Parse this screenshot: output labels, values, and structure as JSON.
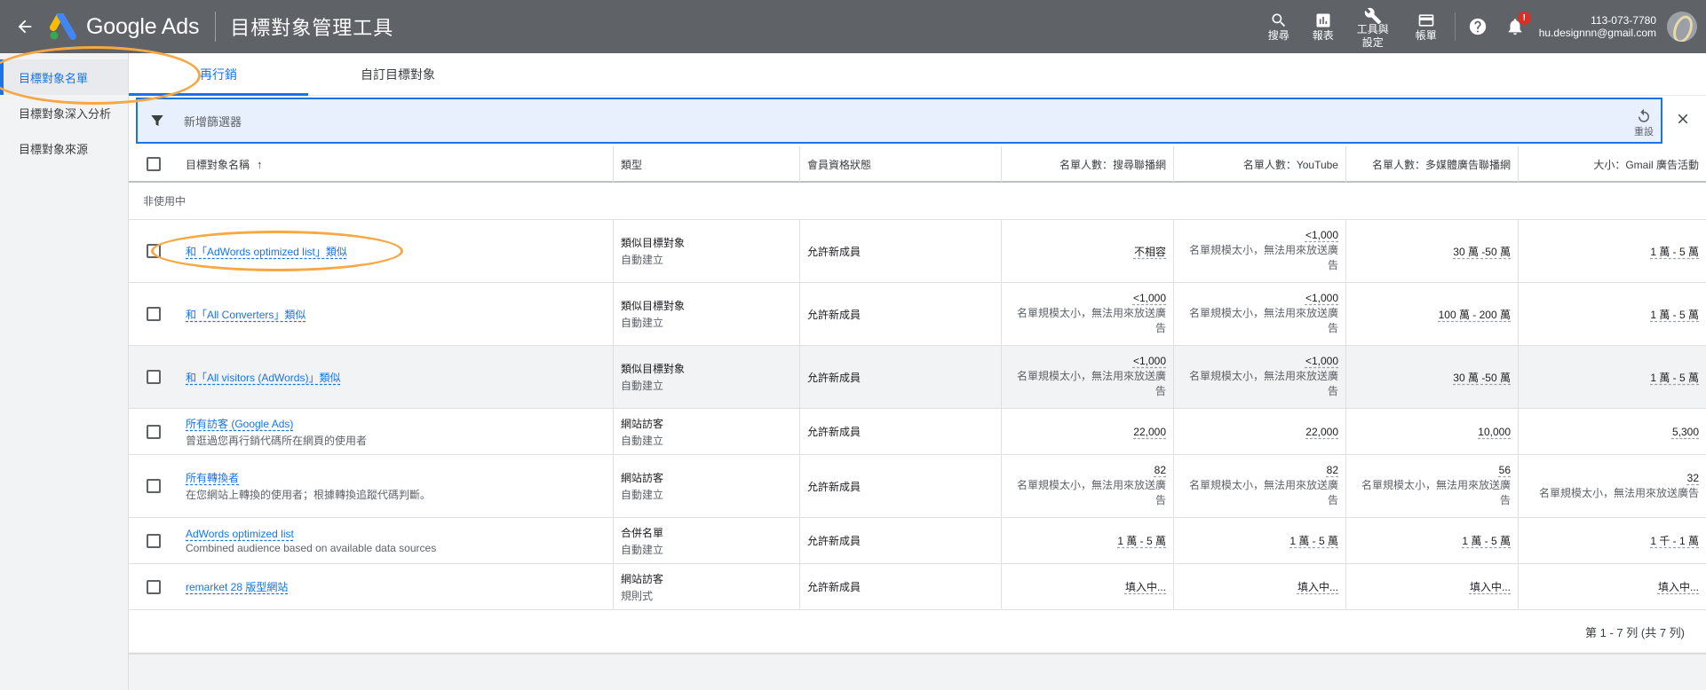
{
  "header": {
    "brand": "Google Ads",
    "title": "目標對象管理工具",
    "search_label": "搜尋",
    "reports_label": "報表",
    "tools_label_1": "工具與",
    "tools_label_2": "設定",
    "billing_label": "帳單",
    "notification_badge": "!",
    "account_id": "113-073-7780",
    "account_email": "hu.designnn@gmail.com"
  },
  "sidebar": {
    "items": [
      {
        "label": "目標對象名單"
      },
      {
        "label": "目標對象深入分析"
      },
      {
        "label": "目標對象來源"
      }
    ]
  },
  "tabs": [
    {
      "label": "再行銷"
    },
    {
      "label": "自訂目標對象"
    }
  ],
  "filter": {
    "placeholder": "新增篩選器",
    "reset_label": "重設"
  },
  "table": {
    "columns": [
      "目標對象名稱",
      "類型",
      "會員資格狀態",
      "名單人數：搜尋聯播網",
      "名單人數：YouTube",
      "名單人數：多媒體廣告聯播網",
      "大小：Gmail 廣告活動"
    ],
    "sort_indicator": "↑",
    "group_label": "非使用中",
    "rows": [
      {
        "name": "和「AdWords optimized list」類似",
        "desc": "",
        "type": "類似目標對象",
        "type_sub": "自動建立",
        "status": "允許新成員",
        "search": "不相容",
        "search_note": "",
        "youtube": "<1,000",
        "youtube_note": "名單規模太小，無法用來放送廣告",
        "display": "30 萬 -50 萬",
        "display_note": "",
        "gmail": "1 萬 - 5 萬",
        "gmail_note": ""
      },
      {
        "name": "和「All Converters」類似",
        "desc": "",
        "type": "類似目標對象",
        "type_sub": "自動建立",
        "status": "允許新成員",
        "search": "<1,000",
        "search_note": "名單規模太小，無法用來放送廣告",
        "youtube": "<1,000",
        "youtube_note": "名單規模太小，無法用來放送廣告",
        "display": "100 萬 - 200 萬",
        "display_note": "",
        "gmail": "1 萬 - 5 萬",
        "gmail_note": ""
      },
      {
        "name": "和「All visitors (AdWords)」類似",
        "desc": "",
        "type": "類似目標對象",
        "type_sub": "自動建立",
        "status": "允許新成員",
        "search": "<1,000",
        "search_note": "名單規模太小，無法用來放送廣告",
        "youtube": "<1,000",
        "youtube_note": "名單規模太小，無法用來放送廣告",
        "display": "30 萬 -50 萬",
        "display_note": "",
        "gmail": "1 萬 - 5 萬",
        "gmail_note": ""
      },
      {
        "name": "所有訪客 (Google Ads)",
        "desc": "曾逛過您再行銷代碼所在網頁的使用者",
        "type": "網站訪客",
        "type_sub": "自動建立",
        "status": "允許新成員",
        "search": "22,000",
        "search_note": "",
        "youtube": "22,000",
        "youtube_note": "",
        "display": "10,000",
        "display_note": "",
        "gmail": "5,300",
        "gmail_note": ""
      },
      {
        "name": "所有轉換者",
        "desc": "在您網站上轉換的使用者；根據轉換追蹤代碼判斷。",
        "type": "網站訪客",
        "type_sub": "自動建立",
        "status": "允許新成員",
        "search": "82",
        "search_note": "名單規模太小，無法用來放送廣告",
        "youtube": "82",
        "youtube_note": "名單規模太小，無法用來放送廣告",
        "display": "56",
        "display_note": "名單規模太小，無法用來放送廣告",
        "gmail": "32",
        "gmail_note": "名單規模太小，無法用來放送廣告"
      },
      {
        "name": "AdWords optimized list",
        "desc": "Combined audience based on available data sources",
        "type": "合併名單",
        "type_sub": "自動建立",
        "status": "允許新成員",
        "search": "1 萬 - 5 萬",
        "search_note": "",
        "youtube": "1 萬 - 5 萬",
        "youtube_note": "",
        "display": "1 萬 - 5 萬",
        "display_note": "",
        "gmail": "1 千 - 1 萬",
        "gmail_note": ""
      },
      {
        "name": "remarket 28 版型網站",
        "desc": "",
        "type": "網站訪客",
        "type_sub": "規則式",
        "status": "允許新成員",
        "search": "填入中...",
        "search_note": "",
        "youtube": "填入中...",
        "youtube_note": "",
        "display": "填入中...",
        "display_note": "",
        "gmail": "填入中...",
        "gmail_note": ""
      }
    ],
    "pagination": "第 1 - 7 列 (共 7 列)"
  },
  "colors": {
    "header_bg": "#5f6368",
    "accent": "#1a73e8",
    "annotation": "#f7a743"
  }
}
